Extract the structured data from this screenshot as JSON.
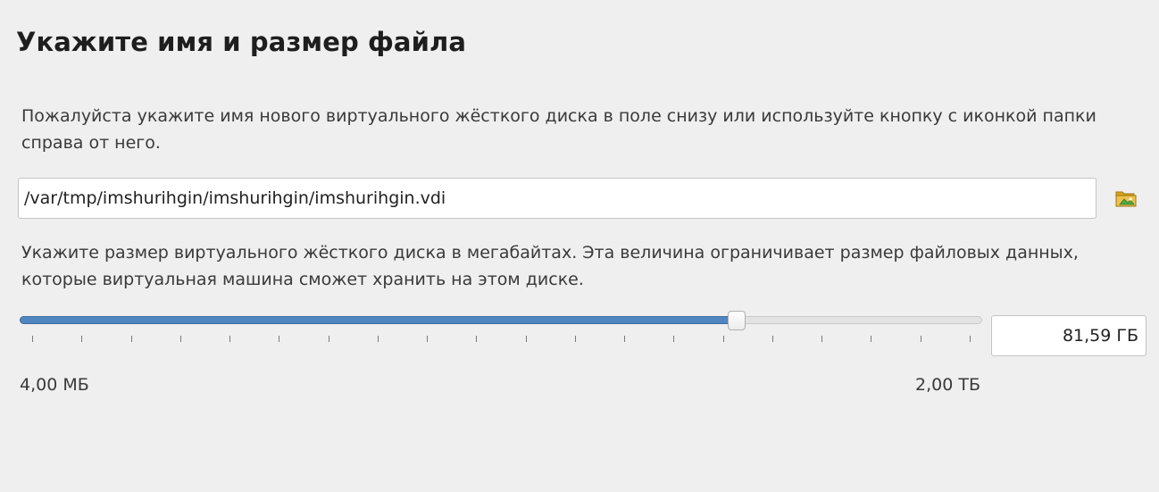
{
  "page": {
    "title": "Укажите имя и размер файла"
  },
  "location": {
    "description": "Пожалуйста укажите имя нового виртуального жёсткого диска в поле снизу или используйте кнопку с иконкой папки справа от него.",
    "path_value": "/var/tmp/imshurihgin/imshurihgin/imshurihgin.vdi",
    "folder_icon": "folder-icon"
  },
  "size": {
    "description": "Укажите размер виртуального жёсткого диска в мегабайтах. Эта величина ограничивает размер файловых данных, которые виртуальная машина сможет хранить на этом диске.",
    "value": "81,59 ГБ",
    "min_label": "4,00 МБ",
    "max_label": "2,00 ТБ",
    "slider_fraction": 0.745,
    "tick_count": 20
  },
  "colors": {
    "slider_fill": "#4f86c0",
    "background": "#efefef"
  }
}
